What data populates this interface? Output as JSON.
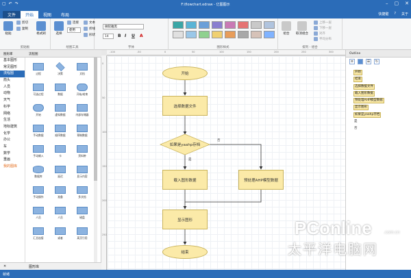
{
  "window": {
    "title": "F:\\flowchart.edraw - 亿图图示"
  },
  "tabs": {
    "file": "文件",
    "items": [
      "开始",
      "视图",
      "布局"
    ],
    "active": "开始",
    "right": [
      "快捷键",
      "?",
      "关于"
    ]
  },
  "ribbon": {
    "clipboard": {
      "paste": "粘贴",
      "cut": "剪切",
      "copy": "复制",
      "brush": "格式刷",
      "label": "剪贴板"
    },
    "tools": {
      "select": "选择",
      "shape": "形状",
      "connect": "连接",
      "text": "文本",
      "line": "折线",
      "label": "绘图工具",
      "menu": "使用"
    },
    "font": {
      "name": "微软雅黑",
      "size": "14",
      "label": "字体",
      "bold": "B",
      "italic": "I",
      "underline": "U",
      "color": "A"
    },
    "style": {
      "label": "图形样式",
      "colors": [
        "#3aa6a6",
        "#5ab4d6",
        "#6b9fd8",
        "#8a7fd0",
        "#c97ab5",
        "#e57373",
        "#c9c9c9",
        "#b0c4de",
        "#e0e0e0",
        "#9ac7e8",
        "#8fd18f",
        "#f0d070",
        "#e89d5a",
        "#a8a8a8",
        "#d6c2b8",
        "#80b3ff"
      ]
    },
    "arrange": {
      "group": "组合",
      "ungroup": "取消组合",
      "items": [
        "上移一层",
        "下移一层",
        "对齐",
        "平均分布"
      ],
      "label": "排列 - 组合"
    }
  },
  "library": {
    "header_left": "图形库",
    "header_right": "流程图",
    "categories": [
      "基本图形",
      "常见图形",
      "流程图",
      "箭头",
      "人员",
      "动物",
      "天气",
      "科学",
      "网络",
      "生活",
      "地标建筑",
      "化学",
      "办公",
      "车",
      "数学",
      "重画",
      "我的图库"
    ],
    "active": "流程图",
    "shapes": [
      "过程",
      "决策",
      "文档",
      "可选过程",
      "数据",
      "开始/结束",
      "开始",
      "虚拟数据",
      "内部存储器",
      "手动数据",
      "顺序数据",
      "预制数据",
      "手动输入",
      "卡",
      "资料带",
      "数据库",
      "延迟",
      "显示内容",
      "手动操作",
      "准备",
      "多文档",
      "人员",
      "人员",
      "磁盘",
      "汇总连接",
      "或者",
      "离页引用"
    ],
    "footer": "图形库",
    "close": "✕"
  },
  "ruler": {
    "h": [
      "-100",
      "-50",
      "0",
      "50",
      "100",
      "150",
      "200",
      "250",
      "300"
    ],
    "v": [
      "0",
      "50",
      "100",
      "150",
      "200",
      "250"
    ]
  },
  "flow": {
    "start": "开始",
    "select_file": "选择数据文件",
    "decision": "如果是yaahp存档",
    "load": "载入图形数据",
    "preprocess": "预处理AHP模型数据",
    "show": "显示图形",
    "end": "结束",
    "yes": "是",
    "no": "否"
  },
  "outline": {
    "title": "Outline",
    "items": [
      "开始",
      "结束",
      "选择数据文件",
      "载入图形数据",
      "预处理AHP模型数据",
      "显示图形",
      "如果是yaahp存档",
      "是",
      "否"
    ]
  },
  "status": {
    "text": "就绪"
  },
  "watermark": {
    "brand": "PConline",
    "domain": ".com.cn",
    "cn": "太平洋电脑网"
  }
}
